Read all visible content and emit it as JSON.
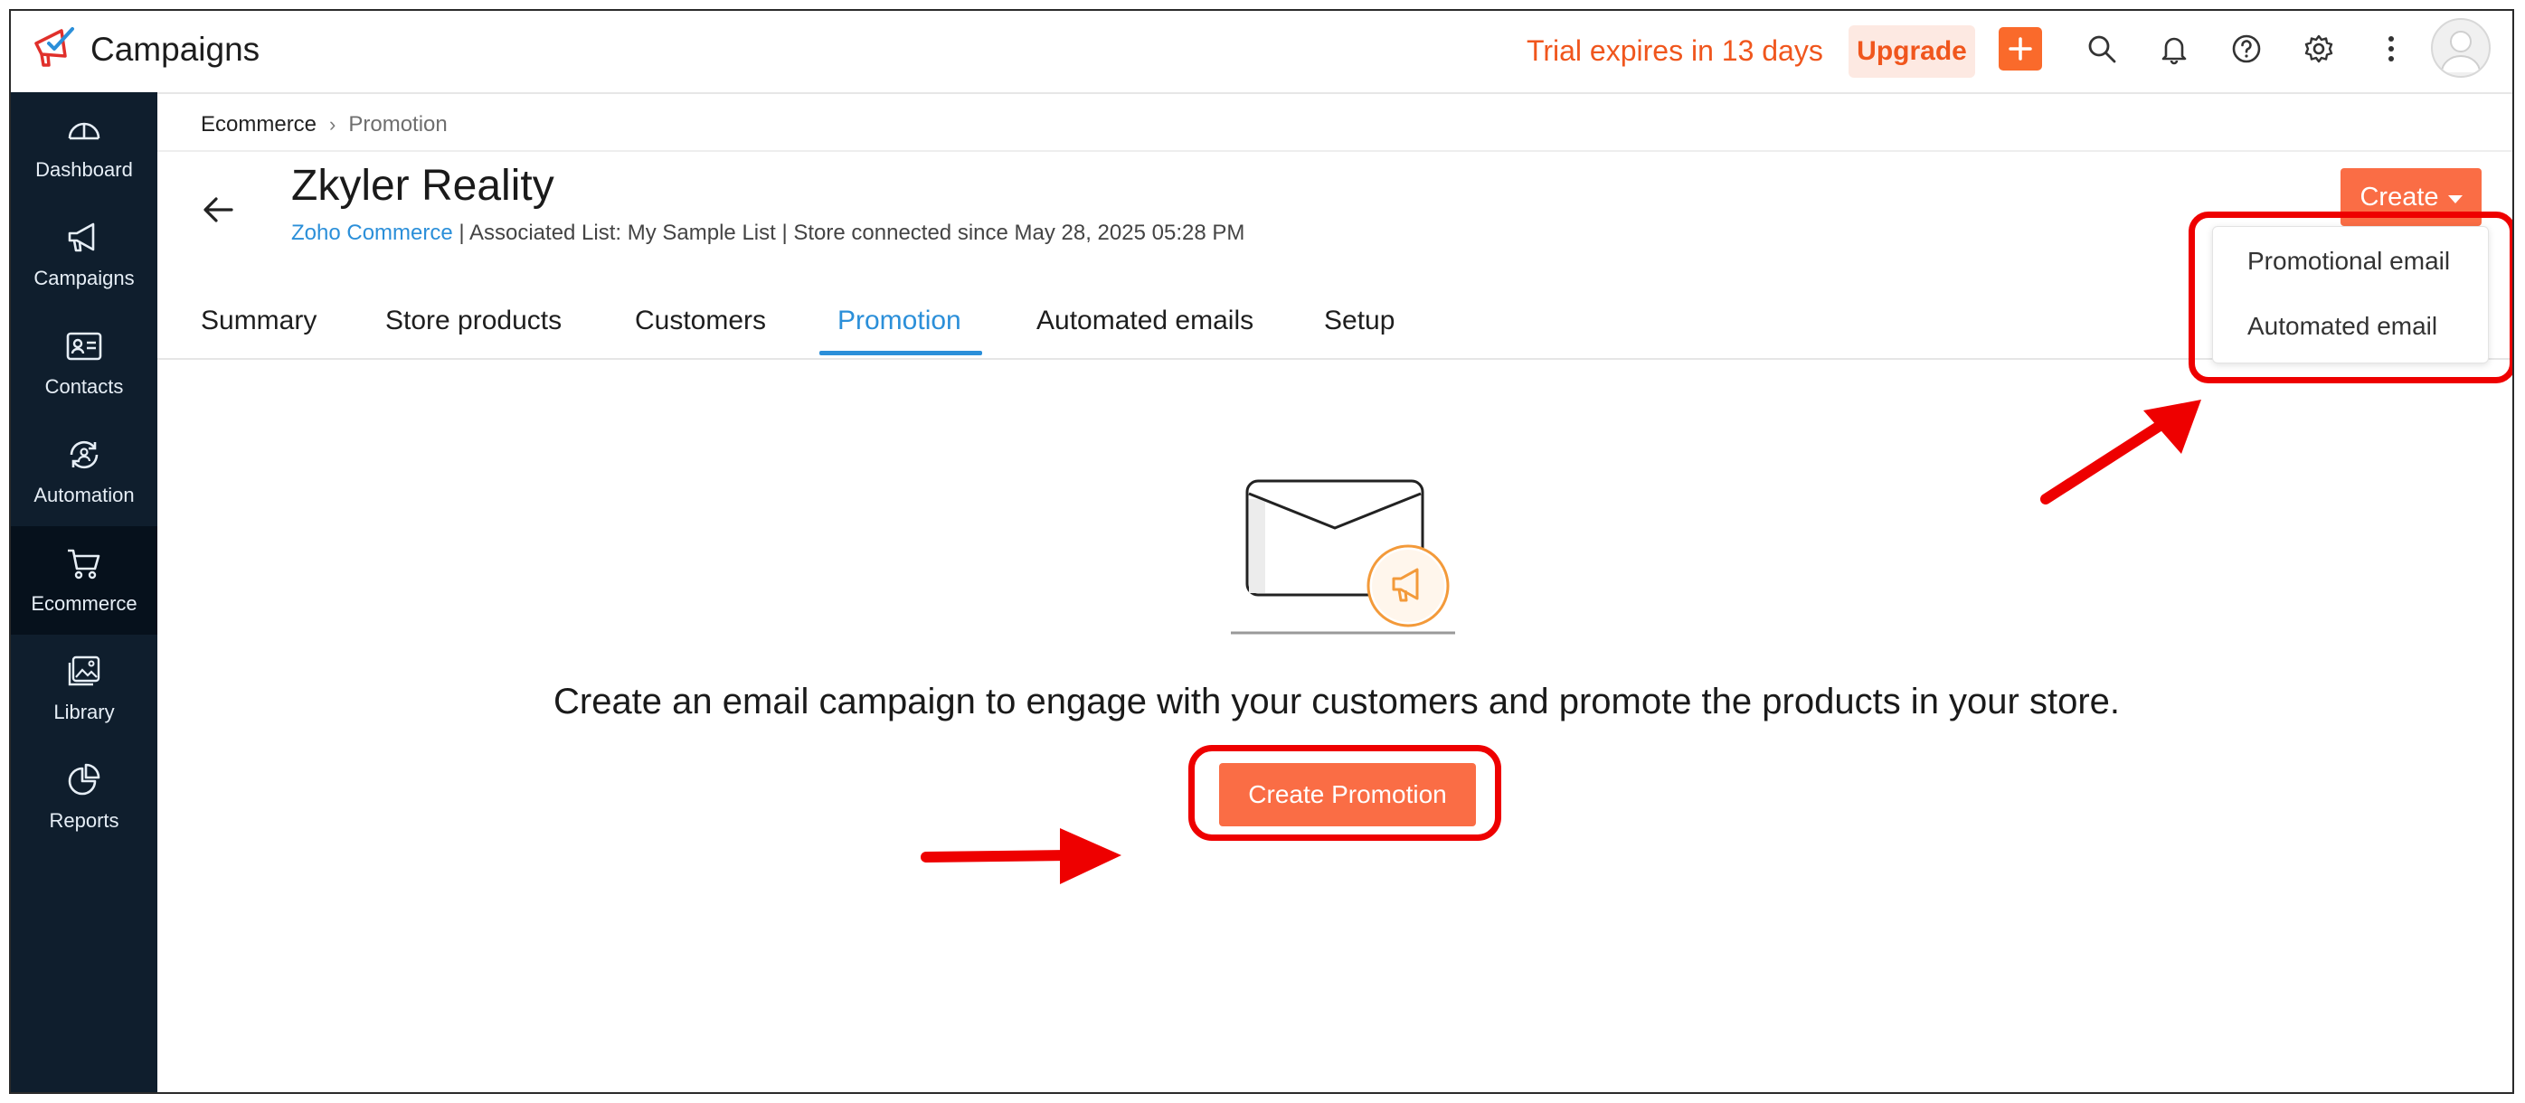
{
  "app": {
    "title": "Campaigns",
    "trial_text": "Trial expires in 13 days",
    "upgrade_label": "Upgrade"
  },
  "sidebar": {
    "items": [
      {
        "label": "Dashboard",
        "icon": "gauge-icon"
      },
      {
        "label": "Campaigns",
        "icon": "megaphone-icon"
      },
      {
        "label": "Contacts",
        "icon": "contact-card-icon"
      },
      {
        "label": "Automation",
        "icon": "automation-icon"
      },
      {
        "label": "Ecommerce",
        "icon": "cart-icon",
        "active": true
      },
      {
        "label": "Library",
        "icon": "image-library-icon"
      },
      {
        "label": "Reports",
        "icon": "pie-chart-icon"
      }
    ]
  },
  "breadcrumb": {
    "parent": "Ecommerce",
    "current": "Promotion"
  },
  "store": {
    "name": "Zkyler Reality",
    "platform": "Zoho Commerce",
    "associated_list": "| Associated List: My Sample List",
    "connected": "| Store connected since May 28, 2025 05:28 PM"
  },
  "create_button": {
    "label": "Create"
  },
  "create_menu": {
    "items": [
      "Promotional email",
      "Automated email"
    ]
  },
  "tabs": [
    "Summary",
    "Store products",
    "Customers",
    "Promotion",
    "Automated emails",
    "Setup"
  ],
  "active_tab": "Promotion",
  "empty_state": {
    "message": "Create an email campaign to engage with your customers and promote the products in your store.",
    "cta_label": "Create Promotion"
  },
  "colors": {
    "accent": "#fa6d45",
    "link": "#2b8fd9",
    "sidebar_bg": "#0f1e2d",
    "annotation": "#e00000"
  }
}
